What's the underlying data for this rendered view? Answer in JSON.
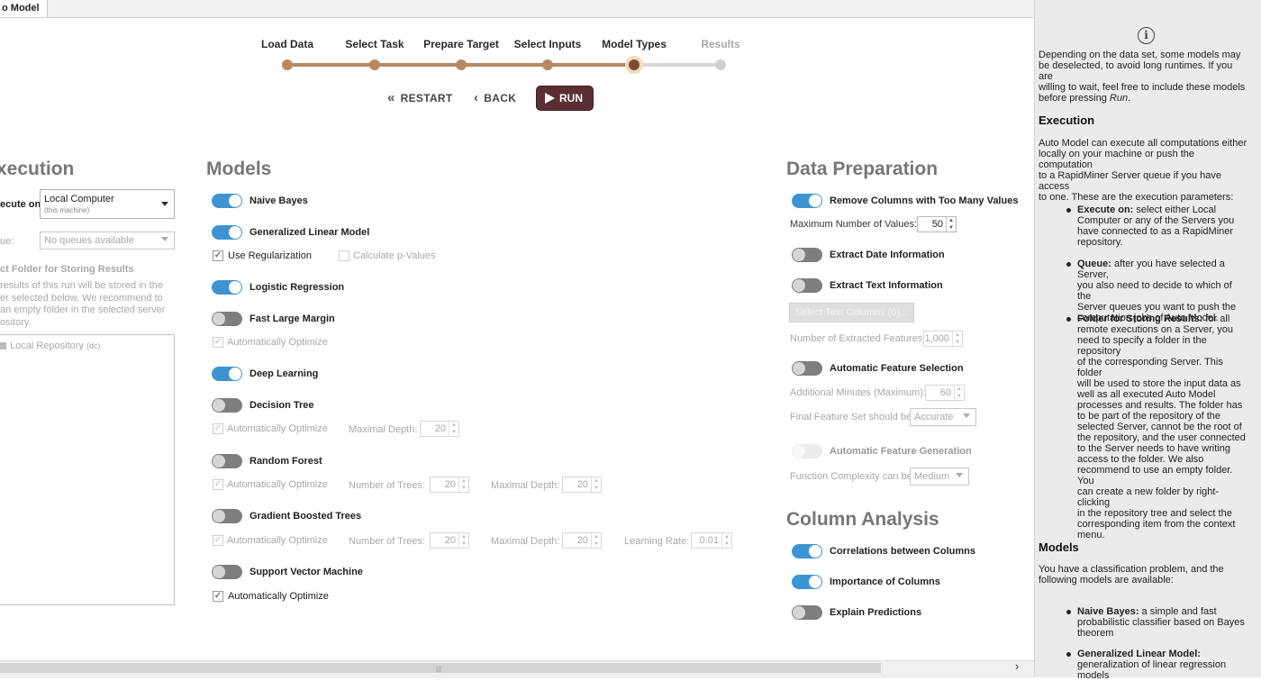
{
  "tab": {
    "title": "o Model"
  },
  "wizard": {
    "steps": [
      {
        "label": "Load Data",
        "state": "done"
      },
      {
        "label": "Select Task",
        "state": "done"
      },
      {
        "label": "Prepare Target",
        "state": "done"
      },
      {
        "label": "Select Inputs",
        "state": "done"
      },
      {
        "label": "Model Types",
        "state": "current"
      },
      {
        "label": "Results",
        "state": "future"
      }
    ],
    "restart_label": "RESTART",
    "back_label": "BACK",
    "run_label": "RUN"
  },
  "execution": {
    "heading": "xecution",
    "execute_on_label": "ecute on:",
    "execute_on_value": "Local Computer",
    "execute_on_sub": "(this machine)",
    "queue_label": "ue:",
    "queue_value": "No queues available",
    "folder_heading": "ct Folder for Storing Results",
    "folder_desc_lines": [
      "results of this run will be stored in the",
      "er selected below. We recommend to",
      "an empty folder in the selected server",
      "ository."
    ],
    "repo_item": "Local Repository",
    "repo_item_sub": "(dc)"
  },
  "models": {
    "heading": "Models",
    "naive_bayes": "Naive Bayes",
    "glm": "Generalized Linear Model",
    "use_regularization": "Use Regularization",
    "calc_pvalues": "Calculate p-Values",
    "logistic_regression": "Logistic Regression",
    "fast_large_margin": "Fast Large Margin",
    "flm_auto": "Automatically Optimize",
    "deep_learning": "Deep Learning",
    "decision_tree": "Decision Tree",
    "dt_auto": "Automatically Optimize",
    "dt_depth_label": "Maximal Depth:",
    "dt_depth": "20",
    "random_forest": "Random Forest",
    "rf_auto": "Automatically Optimize",
    "rf_trees_label": "Number of Trees:",
    "rf_trees": "20",
    "rf_depth_label": "Maximal Depth:",
    "rf_depth": "20",
    "gbt": "Gradient Boosted Trees",
    "gbt_auto": "Automatically Optimize",
    "gbt_trees_label": "Number of Trees:",
    "gbt_trees": "20",
    "gbt_depth_label": "Maximal Depth:",
    "gbt_depth": "20",
    "gbt_lr_label": "Learning Rate:",
    "gbt_lr": "0.01",
    "svm": "Support Vector Machine",
    "svm_auto": "Automatically Optimize"
  },
  "data_prep": {
    "heading": "Data Preparation",
    "remove_cols": "Remove Columns with Too Many Values",
    "max_values_label": "Maximum Number of Values:",
    "max_values": "50",
    "extract_date": "Extract Date Information",
    "extract_text": "Extract Text Information",
    "select_text_btn": "Select Text Columns (0)...",
    "num_extracted_label": "Number of Extracted Features:",
    "num_extracted": "1,000",
    "auto_feat_sel": "Automatic Feature Selection",
    "add_minutes_label": "Additional Minutes (Maximum):",
    "add_minutes": "60",
    "final_set_label": "Final Feature Set should be",
    "final_set_value": "Accurate",
    "auto_feat_gen": "Automatic Feature Generation",
    "func_complexity_label": "Function Complexity can be",
    "func_complexity_value": "Medium"
  },
  "column_analysis": {
    "heading": "Column Analysis",
    "correlations": "Correlations between Columns",
    "importance": "Importance of Columns",
    "explain": "Explain Predictions"
  },
  "help": {
    "intro_lines": [
      "Depending on the data set, some models may",
      "be deselected, to avoid long runtimes. If you are",
      "willing to wait, feel free to include these models",
      "before pressing"
    ],
    "intro_run": "Run",
    "intro_period": ".",
    "execution_heading": "Execution",
    "execution_lines": [
      "Auto Model can execute all computations either",
      "locally on your machine or push the computation",
      "to a RapidMiner Server queue if you have access",
      "to one. These are the execution parameters:"
    ],
    "b1_title": "Execute on:",
    "b1_lines": [
      " select either Local",
      "Computer or any of the Servers you",
      "have connected to as a RapidMiner",
      "repository."
    ],
    "b2_title": "Queue:",
    "b2_lines": [
      " after you have selected a Server,",
      "you also need to decide to which of the",
      "Server queues you want to push the",
      "computation jobs of Auto Model."
    ],
    "b3_title": "Folder for Storing Results:",
    "b3_lines": [
      " for all",
      "remote executions on a Server, you",
      "need to specify a folder in the repository",
      "of the corresponding Server. This folder",
      "will be used to store the input data as",
      "well as all executed Auto Model",
      "processes and results. The folder has",
      "to be part of the repository of the",
      "selected Server, cannot be the root of",
      "the repository, and the user connected",
      "to the Server needs to have writing",
      "access to the folder. We also",
      "recommend to use an empty folder. You",
      "can create a new folder by right-clicking",
      "in the repository tree and select the",
      "corresponding item from the context",
      "menu."
    ],
    "models_heading": "Models",
    "models_lines": [
      "You have a classification problem, and the",
      "following models are available:"
    ],
    "b4_title": "Naive Bayes:",
    "b4_lines": [
      " a simple and fast",
      "probabilistic classifier based on Bayes",
      "theorem"
    ],
    "b5_title": "Generalized Linear Model:",
    "b5_lines": [
      "generalization of linear regression",
      "models"
    ]
  }
}
